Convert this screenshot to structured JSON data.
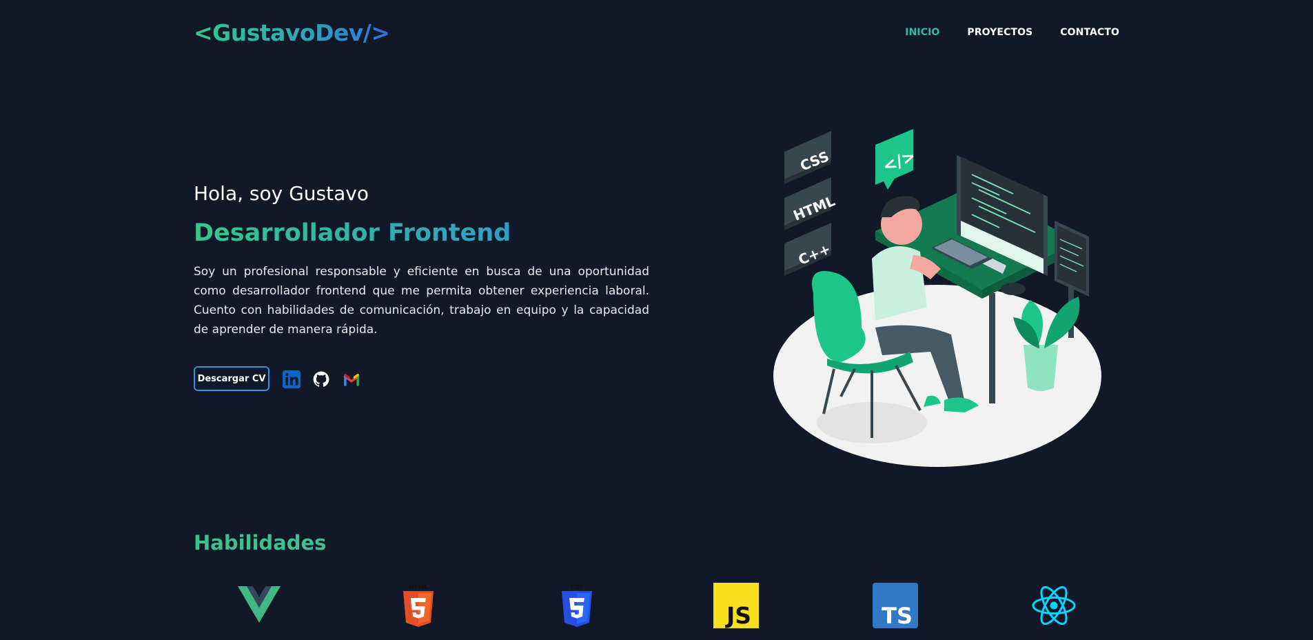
{
  "header": {
    "logo": "<GustavoDev/>",
    "nav": [
      {
        "label": "INICIO",
        "active": true
      },
      {
        "label": "PROYECTOS",
        "active": false
      },
      {
        "label": "CONTACTO",
        "active": false
      }
    ]
  },
  "hero": {
    "greeting": "Hola, soy Gustavo",
    "role": "Desarrollador Frontend",
    "bio": "Soy un profesional responsable y eficiente en busca de una oportunidad como desarrollador frontend que me permita obtener experiencia laboral. Cuento con habilidades de comunicación, trabajo en equipo y la capacidad de aprender de manera rápida.",
    "cv_button": "Descargar CV",
    "social": [
      {
        "icon": "linkedin-icon"
      },
      {
        "icon": "github-icon"
      },
      {
        "icon": "gmail-icon"
      }
    ],
    "illustration_labels": [
      "CSS",
      "HTML",
      "C++",
      "</>"
    ]
  },
  "skills": {
    "title": "Habilidades",
    "items": [
      {
        "icon": "vue-icon",
        "badge": ""
      },
      {
        "icon": "html5-icon",
        "badge": "HTML"
      },
      {
        "icon": "css3-icon",
        "badge": "CSS"
      },
      {
        "icon": "javascript-icon",
        "badge": "JS"
      },
      {
        "icon": "typescript-icon",
        "badge": "TS"
      },
      {
        "icon": "react-icon",
        "badge": ""
      }
    ]
  },
  "colors": {
    "background": "#111827",
    "accent_green": "#34c98a",
    "accent_blue": "#2f6fe0"
  }
}
